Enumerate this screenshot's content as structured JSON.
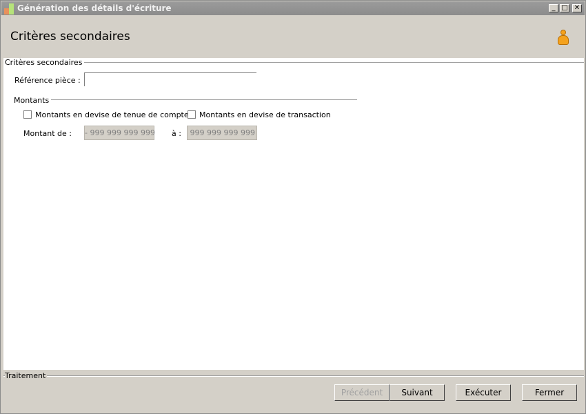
{
  "window": {
    "title": "Génération des détails d'écriture",
    "controls": {
      "minimize": "_",
      "maximize": "□",
      "close": "✕"
    }
  },
  "header": {
    "title": "Critères secondaires",
    "user_icon": "user-icon"
  },
  "group": {
    "title": "Critères secondaires"
  },
  "reference": {
    "label": "Référence pièce :",
    "value": ""
  },
  "montants": {
    "title": "Montants",
    "checkbox_account_currency": {
      "label": "Montants en devise de tenue de compte",
      "checked": false
    },
    "checkbox_transaction_currency": {
      "label": "Montants en devise de transaction",
      "checked": false
    },
    "from_label": "Montant de :",
    "from_value": "- 999 999 999 999",
    "to_label": "à :",
    "to_value": "999 999 999 999"
  },
  "footer": {
    "title": "Traitement",
    "buttons": {
      "previous": "Précédent",
      "next": "Suivant",
      "execute": "Exécuter",
      "close": "Fermer"
    }
  }
}
